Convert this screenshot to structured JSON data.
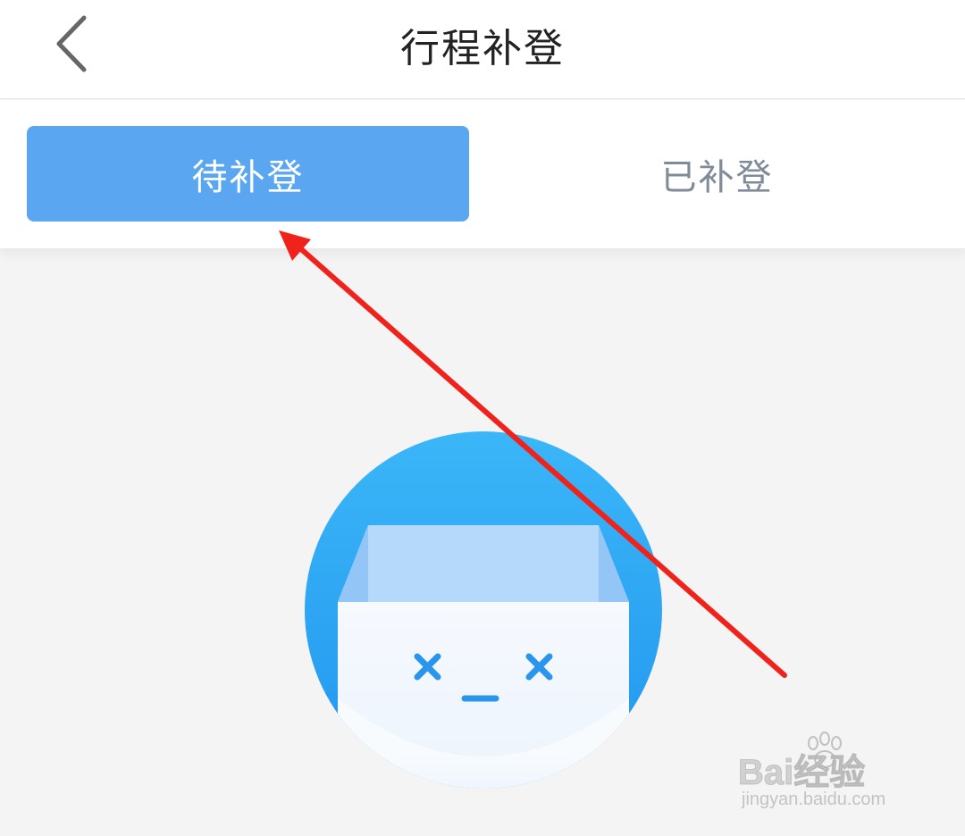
{
  "header": {
    "title": "行程补登",
    "back_icon": "chevron-left-icon"
  },
  "tabs": [
    {
      "label": "待补登",
      "active": true
    },
    {
      "label": "已补登",
      "active": false
    }
  ],
  "empty_state": {
    "icon": "empty-box-icon"
  },
  "annotation": {
    "icon": "red-arrow-icon",
    "color": "#f0221c"
  },
  "watermark": {
    "brand": "Bai经验",
    "url": "jingyan.baidu.com"
  },
  "colors": {
    "accent": "#5aa6f0",
    "inactive_tab_text": "#7f8b99",
    "circle": "#2da8f3",
    "background": "#f4f4f4"
  }
}
